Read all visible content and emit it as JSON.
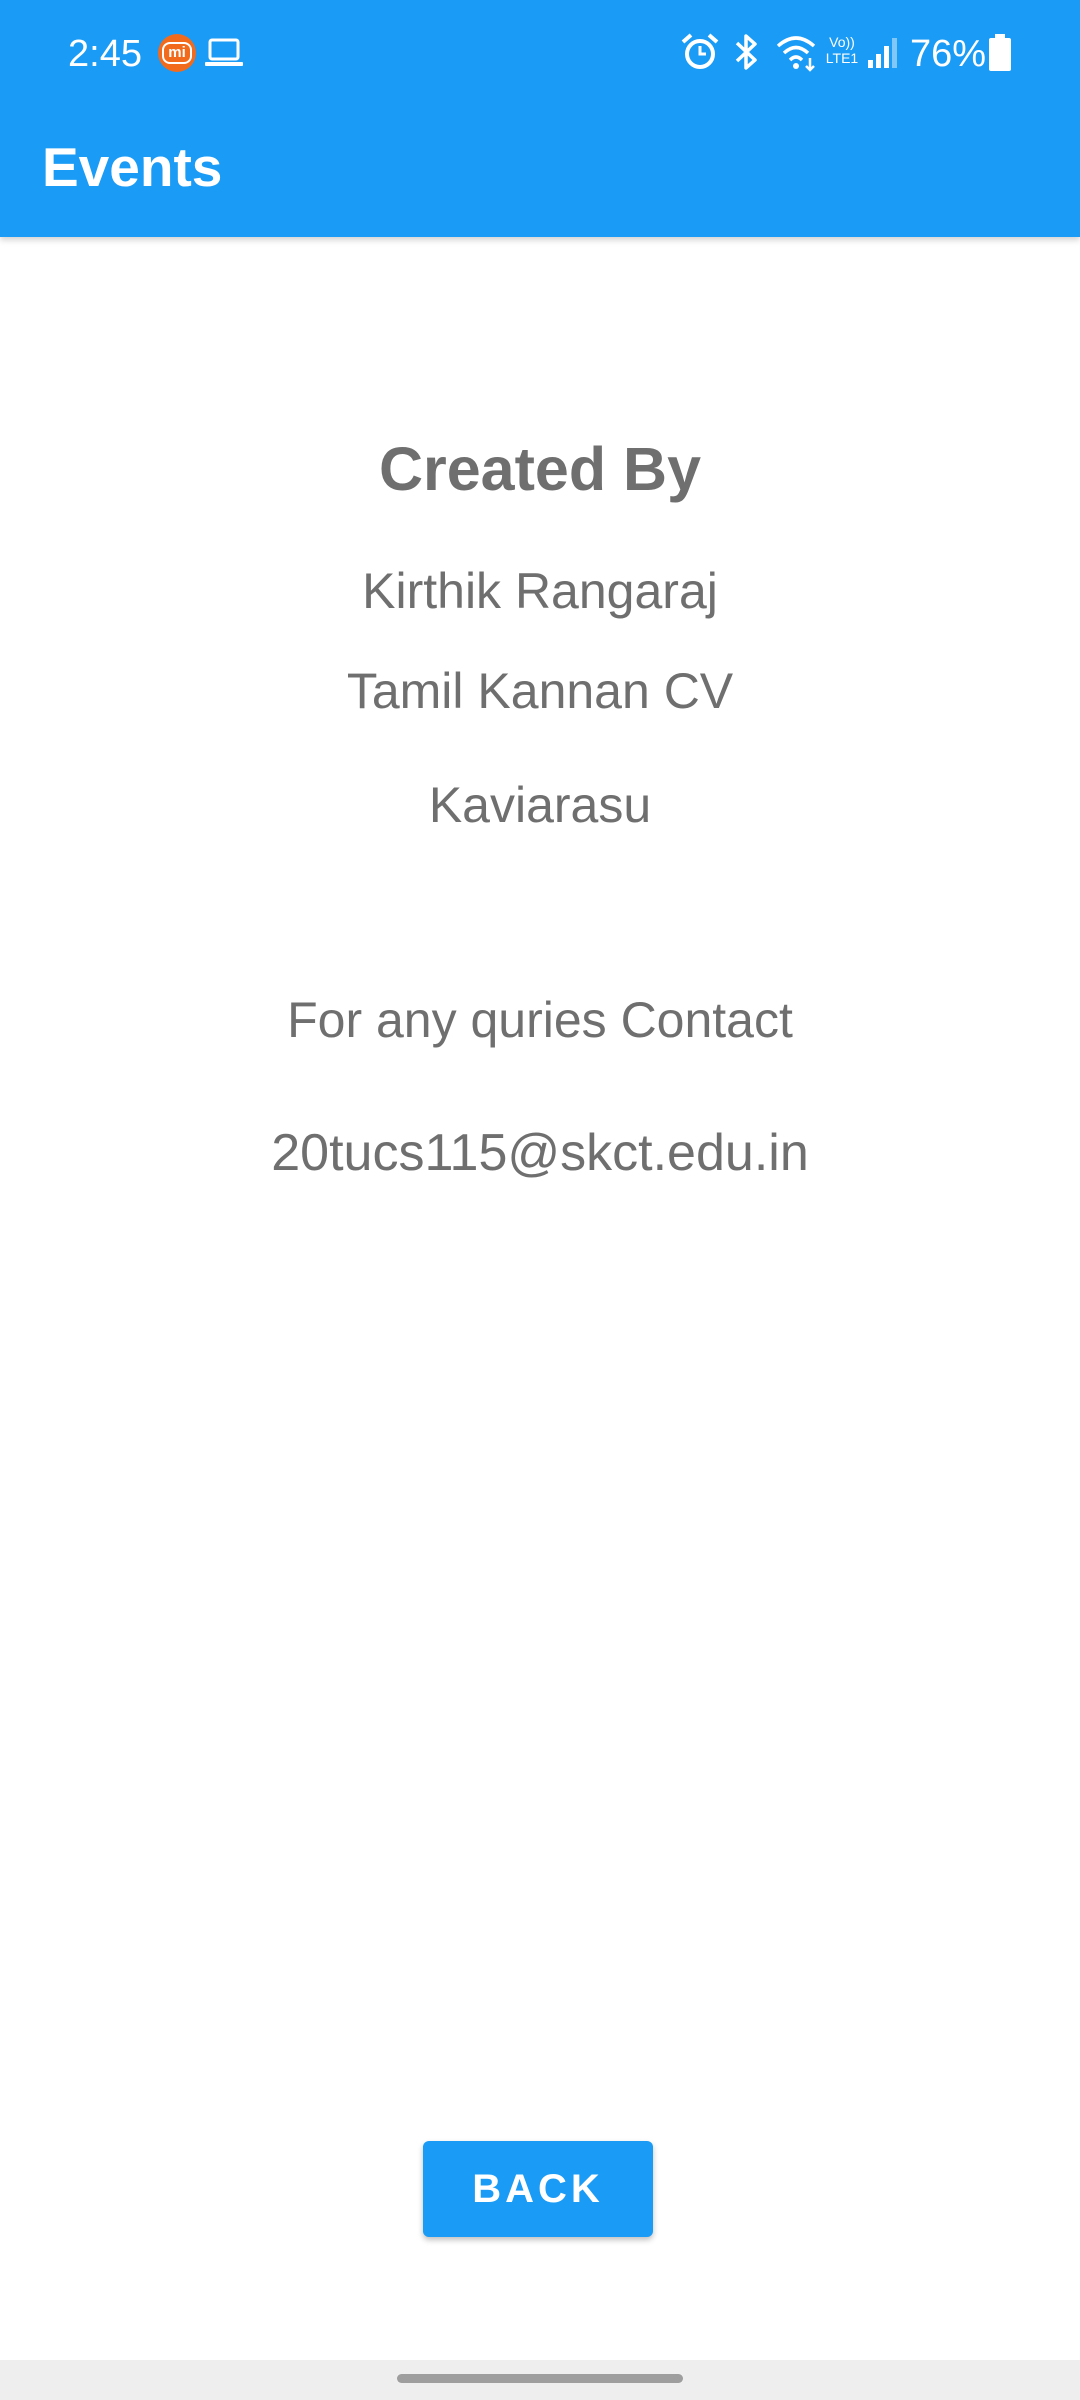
{
  "status_bar": {
    "time": "2:45",
    "battery": "76%",
    "volte": "Vo))\nLTE1",
    "icons": [
      "mi-icon",
      "laptop-icon",
      "alarm-icon",
      "bluetooth-icon",
      "wifi-icon",
      "volte-icon",
      "signal-icon",
      "battery-icon"
    ]
  },
  "app_bar": {
    "title": "Events"
  },
  "main": {
    "heading": "Created By",
    "names": [
      "Kirthik Rangaraj",
      "Tamil Kannan CV",
      "Kaviarasu"
    ],
    "contact_label": "For any quries Contact",
    "contact_email": "20tucs115@skct.edu.in"
  },
  "actions": {
    "back_label": "BACK"
  },
  "colors": {
    "primary": "#1a9bf5",
    "text_gray": "#6f6f6f",
    "mi_orange": "#f26b1d"
  }
}
